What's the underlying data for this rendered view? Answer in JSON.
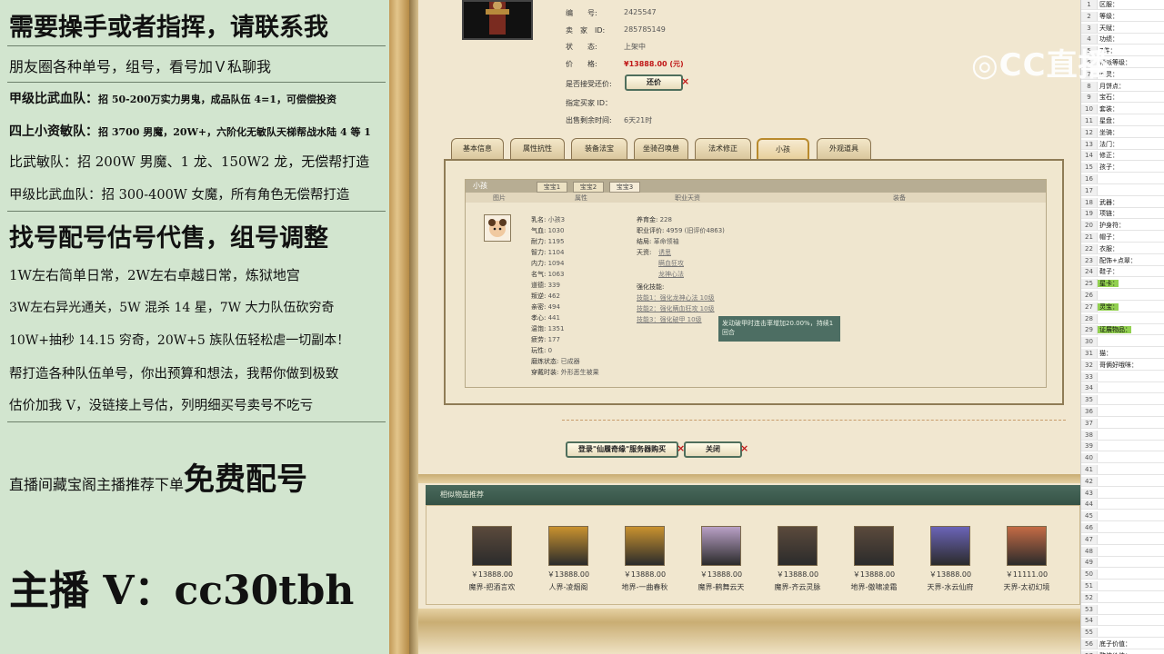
{
  "overlay": {
    "lines": [
      "需要操手或者指挥，请联系我",
      "朋友圈各种单号，组号，看号加Ｖ私聊我",
      "甲级比武血队：",
      "招 50-200万实力男鬼，成品队伍 4=1，可偿偿投资",
      "四上小资敏队：",
      "招 3700 男魔，20W+，六阶化无敏队天梯帮战水陆 4 等 1",
      "比武敏队：招 200W 男魔、1 龙、150W2 龙，无偿帮打造",
      "甲级比武血队：招 300-400W 女魔，所有角色无偿帮打造",
      "找号配号估号代售，组号调整",
      "1W左右简单日常，2W左右卓越日常，炼狱地宫",
      "3W左右异光通关，5W 混杀 14 星，7W 大力队伍砍穷奇",
      "10W+抽秒 14.15 穷奇，20W+5 族队伍轻松虐一切副本！",
      "帮打造各种队伍单号，你出预算和想法，我帮你做到极致",
      "估价加我 V，没链接上号估，列明细买号卖号不吃亏",
      "直播间藏宝阁主播推荐下单",
      "免费配号",
      "主播 V：cc30tbh"
    ]
  },
  "item": {
    "number_label": "编　　号:",
    "number_value": "2425547",
    "seller_label": "卖　家　ID:",
    "seller_value": "285785149",
    "status_label": "状　　态:",
    "status_value": "上架中",
    "price_label": "价　　格:",
    "price_value": "¥13888.00 (元)",
    "bargain_label": "是否接受还价:",
    "bargain_btn": "还价",
    "buyer_label": "指定买家 ID：",
    "remain_label": "出售剩余时间:",
    "remain_value": "6天21时"
  },
  "tabs": [
    "基本信息",
    "属性抗性",
    "装备法宝",
    "坐骑召唤兽",
    "法术修正",
    "小孩",
    "外观道具"
  ],
  "child": {
    "header": "小孩",
    "subtabs": [
      "宝宝1",
      "宝宝2",
      "宝宝3"
    ],
    "cols": [
      "图片",
      "属性",
      "职业天资",
      "装备"
    ],
    "left_stats": [
      [
        "乳名:",
        "小孩3"
      ],
      [
        "气血:",
        "1030"
      ],
      [
        "耐力:",
        "1195"
      ],
      [
        "智力:",
        "1104"
      ],
      [
        "内力:",
        "1094"
      ],
      [
        "名气:",
        "1063"
      ],
      [
        "道德:",
        "339"
      ],
      [
        "叛逆:",
        "462"
      ],
      [
        "亲密:",
        "494"
      ],
      [
        "孝心:",
        "441"
      ],
      [
        "温饱:",
        "1351"
      ],
      [
        "疲劳:",
        "177"
      ],
      [
        "玩性:",
        "0"
      ],
      [
        "磨炼状态:",
        "已成器"
      ],
      [
        "穿戴时装:",
        "外形恶生被果"
      ]
    ],
    "raise_label": "养育金:",
    "raise_value": "228",
    "eval_label": "职业评价:",
    "eval_value": "4959 (旧评价4863)",
    "result_label": "结局:",
    "result_value": "革命领袖",
    "talent_label": "天资:",
    "talents": [
      "诱思",
      "瞒血狂攻",
      "龙神心法"
    ],
    "skill_label": "强化技能:",
    "skills": [
      "技能1：强化龙神心法 10级",
      "技能2：强化瞒血狂攻 10级",
      "技能3：强化破甲 10级"
    ],
    "tooltip": "发动破甲时连击率增加20.00%，持续1回合"
  },
  "actions": {
    "login_btn": "登录\"仙履奇缘\"服务器购买",
    "close_btn": "关闭"
  },
  "recommend": {
    "title": "相似物品推荐",
    "items": [
      {
        "price": "￥13888.00",
        "name": "魔界-把酒言欢",
        "face": "#5b4a3c"
      },
      {
        "price": "￥13888.00",
        "name": "人界-凌烟阁",
        "face": "#c9922f"
      },
      {
        "price": "￥13888.00",
        "name": "地界-一曲春秋",
        "face": "#c9922f"
      },
      {
        "price": "￥13888.00",
        "name": "魔界-鹤舞云天",
        "face": "#b9a0c6"
      },
      {
        "price": "￥13888.00",
        "name": "魔界-齐云灵脉",
        "face": "#5b4a3c"
      },
      {
        "price": "￥13888.00",
        "name": "地界-傲啸凌霜",
        "face": "#5b4a3c"
      },
      {
        "price": "￥13888.00",
        "name": "天界-水云仙府",
        "face": "#6b64b8"
      },
      {
        "price": "￥11111.00",
        "name": "天界-太初幻境",
        "face": "#c46b45"
      }
    ]
  },
  "sheet": {
    "rows": [
      "区服：",
      "等级：",
      "天赋：",
      "功绩：",
      "7件：",
      "帮派等级：",
      "回灵：",
      "月饼点：",
      "宝石：",
      "套装：",
      "星盘：",
      "坐骑：",
      "法门：",
      "修正：",
      "孩子：",
      "",
      "",
      "武器：",
      "项链：",
      "护身符：",
      "帽子：",
      "衣服：",
      "配饰+点翠：",
      "鞋子：",
      "星卡：",
      "",
      "灵宝：",
      "",
      "证展物品：",
      "",
      "猫：",
      "哥俩好哦咪：",
      "",
      "",
      "",
      "",
      "",
      "",
      "",
      "",
      "",
      "",
      "",
      "",
      "",
      "",
      "",
      "",
      "",
      "",
      "",
      "",
      "",
      "",
      "",
      "底子价值：",
      "整体价值："
    ],
    "highlight_rows": [
      25,
      27,
      29
    ],
    "watermark": "CC直播"
  }
}
